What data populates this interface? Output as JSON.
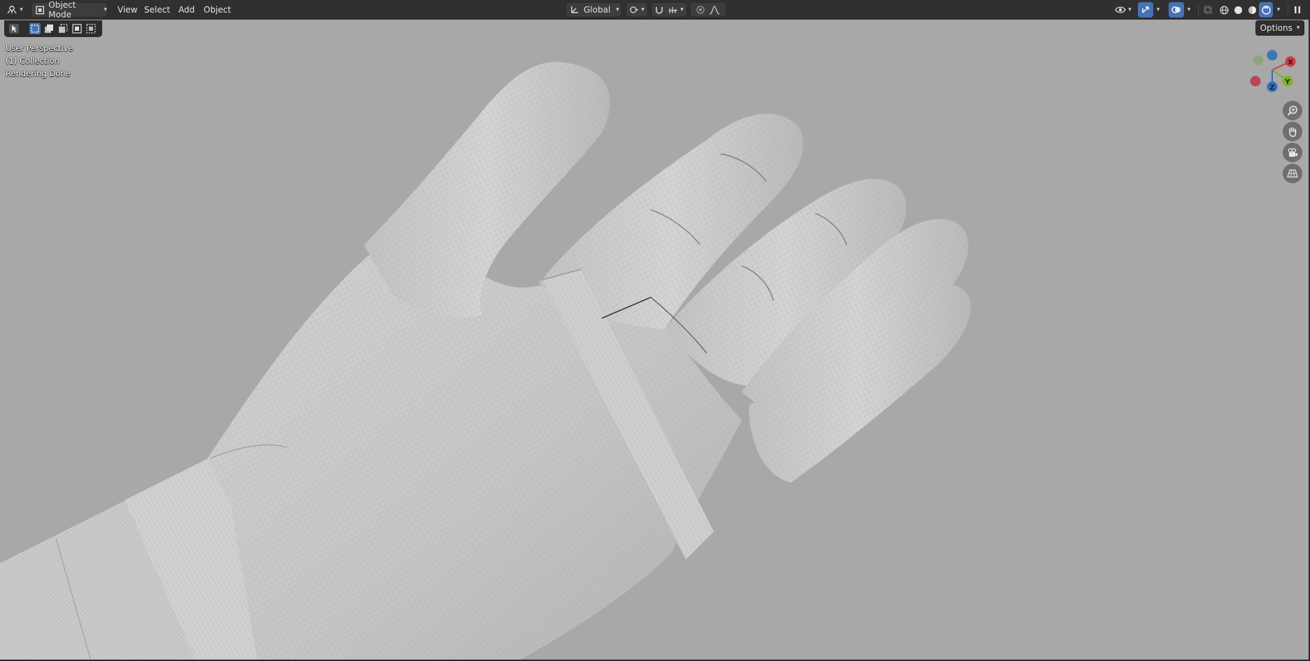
{
  "header": {
    "editor_type": "3d-viewport-icon",
    "mode_label": "Object Mode",
    "menus": [
      "View",
      "Select",
      "Add",
      "Object"
    ],
    "orientation_label": "Global",
    "options_label": "Options"
  },
  "overlay": {
    "view_name": "User Perspective",
    "collection": "(1) Collection",
    "status": "Rendering Done"
  },
  "gizmo": {
    "x_label": "X",
    "y_label": "Y",
    "z_label": "Z",
    "colors": {
      "x": "#d2394a",
      "y": "#7ab31f",
      "z": "#2c6fbd"
    }
  },
  "nav_buttons": [
    "zoom-icon",
    "pan-hand-icon",
    "camera-icon",
    "grid-ortho-icon"
  ],
  "colors": {
    "viewport_bg": "#a8a8a8",
    "header_bg": "#303030",
    "accent": "#4772b3",
    "mesh_base": "#c4c4c4"
  }
}
